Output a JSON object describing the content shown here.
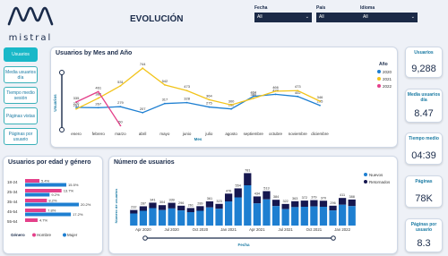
{
  "brand": {
    "name": "mistral"
  },
  "page": {
    "title": "EVOLUCIÓN"
  },
  "filters": [
    {
      "label": "Fecha",
      "value": "All"
    },
    {
      "label": "País",
      "value": "All"
    },
    {
      "label": "Idioma",
      "value": "All"
    }
  ],
  "nav": [
    "Usuarios",
    "Media usuarios día",
    "Tiempo medio sesión",
    "Páginas vistas",
    "Páginas por usuario"
  ],
  "kpis": [
    {
      "label": "Usuarios",
      "value": "9,288"
    },
    {
      "label": "Media usuarios día",
      "value": "8.47"
    },
    {
      "label": "Tiempo medio",
      "value": "04:39"
    },
    {
      "label": "Páginas",
      "value": "78K"
    },
    {
      "label": "Páginas por usuario",
      "value": "8.3"
    }
  ],
  "colors": {
    "accent": "#19b8c8",
    "series2020": "#1e7fd1",
    "series2021": "#f2c41b",
    "series2022": "#e4408a",
    "nuevos": "#1e7fd1",
    "retornados": "#16174f",
    "hombre": "#e4408a",
    "mujer": "#1e7fd1"
  },
  "chart_data": [
    {
      "type": "line",
      "title": "Usuarios by Mes and Año",
      "xlabel": "Mes",
      "ylabel": "Usuarios",
      "categories": [
        "enero",
        "febrero",
        "marzo",
        "abril",
        "mayo",
        "junio",
        "julio",
        "agosto",
        "septiembre",
        "octubre",
        "noviembre",
        "diciembre"
      ],
      "legend_title": "Año",
      "legend_position": "right",
      "series": [
        {
          "name": "2020",
          "values": [
            270,
            267,
            279,
            207,
            317,
            328,
            275,
            252,
            404,
            428,
            402,
            295
          ]
        },
        {
          "name": "2021",
          "values": [
            251,
            382,
            531,
            744,
            542,
            473,
            364,
            300,
            380,
            466,
            473,
            346
          ]
        },
        {
          "name": "2022",
          "values": [
            335,
            461,
            50
          ]
        }
      ]
    },
    {
      "type": "bar",
      "title": "Usuarios por edad y género",
      "categories": [
        "18-24",
        "25-34",
        "35-44",
        "45-54",
        "55-64"
      ],
      "legend_title": "Género",
      "series": [
        {
          "name": "Hombre",
          "values": [
            5.4,
            13.7,
            8.2,
            7.8,
            4.7
          ]
        },
        {
          "name": "Mujer",
          "values": [
            15.5,
            9.2,
            20.2,
            17.2,
            0
          ]
        }
      ],
      "labels_hombre": [
        "5.4%",
        "13.7%",
        "8.2%",
        "7.8%",
        "4.7%"
      ],
      "labels_mujer": [
        "15.5%",
        "9.2%",
        "20.2%",
        "17.2%",
        ""
      ]
    },
    {
      "type": "bar",
      "title": "Número de usuarios",
      "xlabel": "Fecha",
      "ylabel": "Número de usuarios",
      "xticks": [
        "Apr 2020",
        "Jul 2020",
        "Oct 2020",
        "Jan 2021",
        "Apr 2021",
        "Jul 2021",
        "Oct 2021",
        "Jan 2022"
      ],
      "totals": [
        232,
        287,
        341,
        304,
        339,
        296,
        261,
        289,
        361,
        323,
        476,
        554,
        781,
        434,
        513,
        384,
        322,
        363,
        372,
        379,
        370,
        296,
        411,
        388
      ],
      "nuevos": [
        180,
        220,
        260,
        230,
        255,
        225,
        200,
        220,
        270,
        250,
        360,
        420,
        600,
        330,
        390,
        290,
        245,
        275,
        280,
        285,
        280,
        225,
        310,
        290
      ],
      "legend": [
        "Nuevos",
        "Retornados"
      ],
      "legend_position": "right"
    }
  ]
}
